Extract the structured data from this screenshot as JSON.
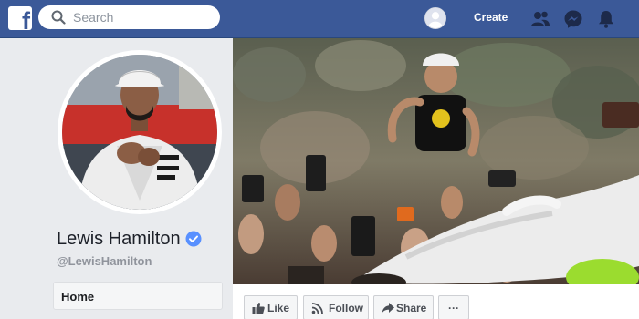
{
  "topbar": {
    "logo_letter": "f",
    "search_placeholder": "Search",
    "create_label": "Create",
    "icons": [
      "facebook-logo-icon",
      "search-icon",
      "user-avatar-icon",
      "friends-icon",
      "messenger-icon",
      "notifications-bell-icon"
    ],
    "background_color": "#3b5998"
  },
  "profile": {
    "name": "Lewis Hamilton",
    "handle": "@LewisHamilton",
    "verified": true
  },
  "left_nav": {
    "items": [
      {
        "label": "Home"
      }
    ]
  },
  "action_bar": {
    "like_label": "Like",
    "follow_label": "Follow",
    "share_label": "Share",
    "more_label": "···"
  },
  "colors": {
    "accent": "#3b5998",
    "verified": "#5890ff",
    "sidebar_bg": "#e9ebee"
  }
}
